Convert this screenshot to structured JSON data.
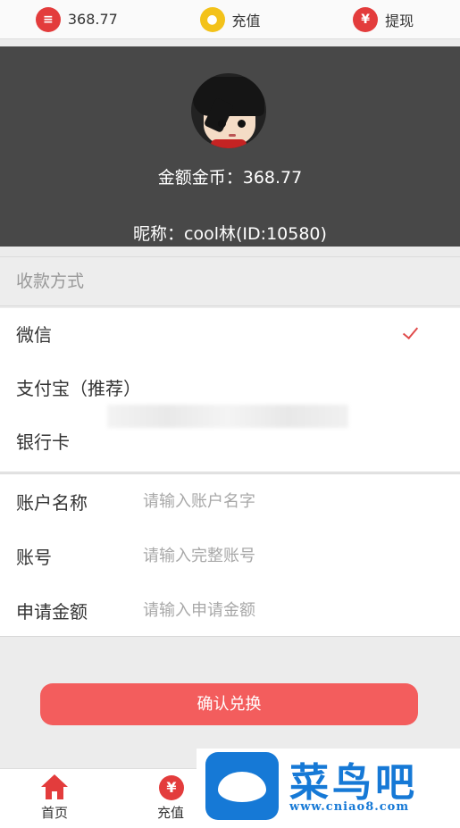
{
  "topbar": {
    "balance": "368.77",
    "recharge_label": "充值",
    "withdraw_label": "提现",
    "withdraw_icon": "¥"
  },
  "profile": {
    "balance_text": "金额金币：368.77",
    "nickname_text": "昵称：cool林(ID:10580)"
  },
  "payment": {
    "section_title": "收款方式",
    "options": [
      {
        "label": "微信",
        "selected": true
      },
      {
        "label": "支付宝（推荐）",
        "selected": false
      },
      {
        "label": "银行卡",
        "selected": false
      }
    ]
  },
  "form": {
    "fields": [
      {
        "label": "账户名称",
        "placeholder": "请输入账户名字"
      },
      {
        "label": "账号",
        "placeholder": "请输入完整账号"
      },
      {
        "label": "申请金额",
        "placeholder": "请输入申请金额"
      }
    ]
  },
  "confirm_label": "确认兑换",
  "bottom_nav": {
    "home_label": "首页",
    "recharge_label": "充值",
    "recharge_icon": "¥"
  },
  "watermark": {
    "brand": "菜鸟吧",
    "url": "www.cniao8.com"
  },
  "colors": {
    "accent": "#e33c3c",
    "button": "#f35d5d",
    "header_bg": "#484848",
    "coin": "#f3c21a",
    "watermark": "#1679d6"
  }
}
